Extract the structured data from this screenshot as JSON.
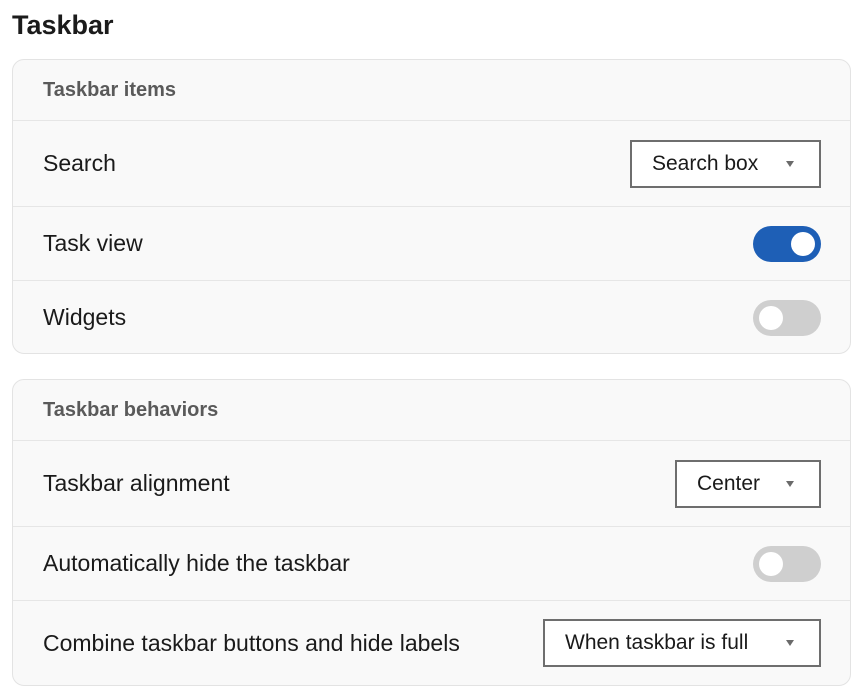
{
  "page": {
    "title": "Taskbar"
  },
  "taskbar_items": {
    "header": "Taskbar items",
    "search": {
      "label": "Search",
      "value": "Search box"
    },
    "task_view": {
      "label": "Task view",
      "state": "on"
    },
    "widgets": {
      "label": "Widgets",
      "state": "off"
    }
  },
  "taskbar_behaviors": {
    "header": "Taskbar behaviors",
    "alignment": {
      "label": "Taskbar alignment",
      "value": "Center"
    },
    "auto_hide": {
      "label": "Automatically hide the taskbar",
      "state": "off"
    },
    "combine": {
      "label": "Combine taskbar buttons and hide labels",
      "value": "When taskbar is full"
    }
  },
  "colors": {
    "accent": "#1e5fb6",
    "toggle_off": "#cfcfcf",
    "card_bg": "#f9f9f9"
  },
  "icons": {
    "dropdown": "chevron-down-icon"
  }
}
